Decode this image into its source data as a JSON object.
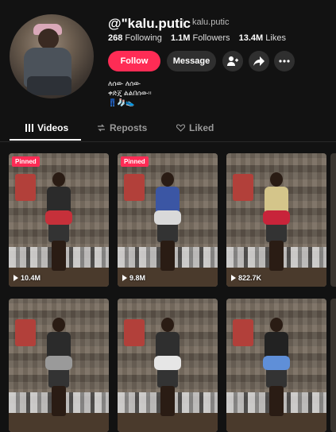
{
  "profile": {
    "username": "@\"kalu.putic",
    "handle": "kalu.putic",
    "stats": [
      {
        "value": "268",
        "label": "Following"
      },
      {
        "value": "1.1M",
        "label": "Followers"
      },
      {
        "value": "13.4M",
        "label": "Likes"
      }
    ],
    "follow_label": "Follow",
    "message_label": "Message",
    "bio_lines": [
      "ለሰው ለሰው",
      "ቀድጄ ልልበሰው፡፡",
      "👖🧦👟"
    ]
  },
  "tabs": [
    {
      "label": "Videos",
      "icon": "grid-icon"
    },
    {
      "label": "Reposts",
      "icon": "repost-icon"
    },
    {
      "label": "Liked",
      "icon": "heart-icon"
    }
  ],
  "videos": [
    {
      "pinned": "Pinned",
      "views": "10.4M",
      "shirt": "#2b2b2b",
      "shoes": "#c6303a"
    },
    {
      "pinned": "Pinned",
      "views": "9.8M",
      "shirt": "#3b56a4",
      "shoes": "#d9d9d9"
    },
    {
      "pinned": "",
      "views": "822.7K",
      "shirt": "#d4c58a",
      "shoes": "#c8243a"
    },
    {
      "pinned": "",
      "views": "",
      "shirt": "#2b2b2b",
      "shoes": "#9a9a9a"
    },
    {
      "pinned": "",
      "views": "",
      "shirt": "#2f2f2f",
      "shoes": "#e6e6e6"
    },
    {
      "pinned": "",
      "views": "",
      "shirt": "#222",
      "shoes": "#5f8fd8"
    }
  ]
}
